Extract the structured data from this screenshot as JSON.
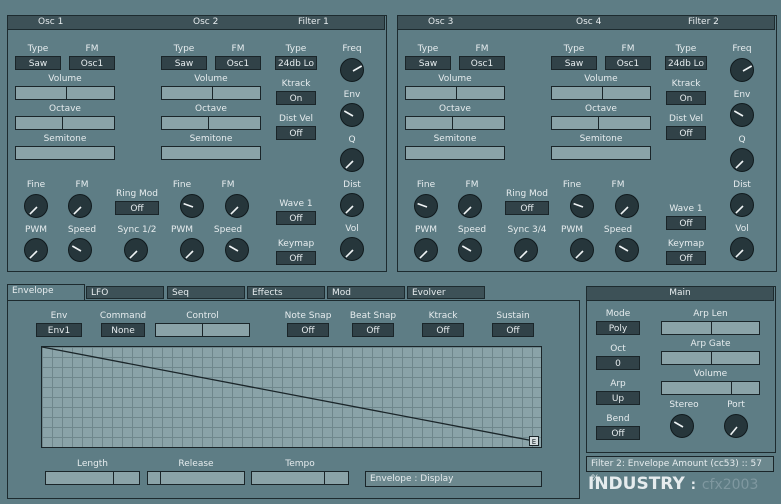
{
  "osc_left": {
    "header": {
      "osc_a": "Osc 1",
      "osc_b": "Osc 2",
      "filter": "Filter 1"
    },
    "osc_a": {
      "type_label": "Type",
      "type_value": "Saw",
      "fm_label": "FM",
      "fm_value": "Osc1",
      "volume_label": "Volume",
      "octave_label": "Octave",
      "semitone_label": "Semitone",
      "fine_label": "Fine",
      "fm_knob_label": "FM",
      "pwm_label": "PWM",
      "speed_label": "Speed"
    },
    "osc_b": {
      "type_label": "Type",
      "type_value": "Saw",
      "fm_label": "FM",
      "fm_value": "Osc1",
      "volume_label": "Volume",
      "octave_label": "Octave",
      "semitone_label": "Semitone",
      "fine_label": "Fine",
      "fm_knob_label": "FM",
      "pwm_label": "PWM",
      "speed_label": "Speed"
    },
    "ringmod_label": "Ring Mod",
    "ringmod_value": "Off",
    "sync_label": "Sync 1/2",
    "filter": {
      "type_label": "Type",
      "type_value": "24db Lo",
      "ktrack_label": "Ktrack",
      "ktrack_value": "On",
      "distvel_label": "Dist Vel",
      "distvel_value": "Off",
      "wave_label": "Wave 1",
      "wave_value": "Off",
      "keymap_label": "Keymap",
      "keymap_value": "Off",
      "freq_label": "Freq",
      "env_label": "Env",
      "q_label": "Q",
      "dist_label": "Dist",
      "vol_label": "Vol"
    }
  },
  "osc_right": {
    "header": {
      "osc_a": "Osc 3",
      "osc_b": "Osc 4",
      "filter": "Filter 2"
    },
    "osc_a": {
      "type_label": "Type",
      "type_value": "Saw",
      "fm_label": "FM",
      "fm_value": "Osc1",
      "volume_label": "Volume",
      "octave_label": "Octave",
      "semitone_label": "Semitone",
      "fine_label": "Fine",
      "fm_knob_label": "FM",
      "pwm_label": "PWM",
      "speed_label": "Speed"
    },
    "osc_b": {
      "type_label": "Type",
      "type_value": "Saw",
      "fm_label": "FM",
      "fm_value": "Osc1",
      "volume_label": "Volume",
      "octave_label": "Octave",
      "semitone_label": "Semitone",
      "fine_label": "Fine",
      "fm_knob_label": "FM",
      "pwm_label": "PWM",
      "speed_label": "Speed"
    },
    "ringmod_label": "Ring Mod",
    "ringmod_value": "Off",
    "sync_label": "Sync 3/4",
    "filter": {
      "type_label": "Type",
      "type_value": "24db Lo",
      "ktrack_label": "Ktrack",
      "ktrack_value": "On",
      "distvel_label": "Dist Vel",
      "distvel_value": "Off",
      "wave_label": "Wave 1",
      "wave_value": "Off",
      "keymap_label": "Keymap",
      "keymap_value": "Off",
      "freq_label": "Freq",
      "env_label": "Env",
      "q_label": "Q",
      "dist_label": "Dist",
      "vol_label": "Vol"
    }
  },
  "tabs": [
    "Envelope",
    "LFO",
    "Seq",
    "Effects",
    "Mod",
    "Evolver"
  ],
  "envelope": {
    "env_label": "Env",
    "env_value": "Env1",
    "command_label": "Command",
    "command_value": "None",
    "control_label": "Control",
    "notesnap_label": "Note Snap",
    "notesnap_value": "Off",
    "beatsnap_label": "Beat Snap",
    "beatsnap_value": "Off",
    "ktrack_label": "Ktrack",
    "ktrack_value": "Off",
    "sustain_label": "Sustain",
    "sustain_value": "Off",
    "end_marker": "E",
    "length_label": "Length",
    "release_label": "Release",
    "tempo_label": "Tempo",
    "display_text": "Envelope : Display"
  },
  "main": {
    "title": "Main",
    "mode_label": "Mode",
    "mode_value": "Poly",
    "oct_label": "Oct",
    "oct_value": "0",
    "arp_label": "Arp",
    "arp_value": "Up",
    "bend_label": "Bend",
    "bend_value": "Off",
    "arplen_label": "Arp Len",
    "arpgate_label": "Arp Gate",
    "volume_label": "Volume",
    "stereo_label": "Stereo",
    "port_label": "Port"
  },
  "status_text": "Filter 2: Envelope Amount (cc53) :: 57 %",
  "brand": {
    "name": "INDUSTRY",
    "sep": ":",
    "author": "cfx2003"
  }
}
